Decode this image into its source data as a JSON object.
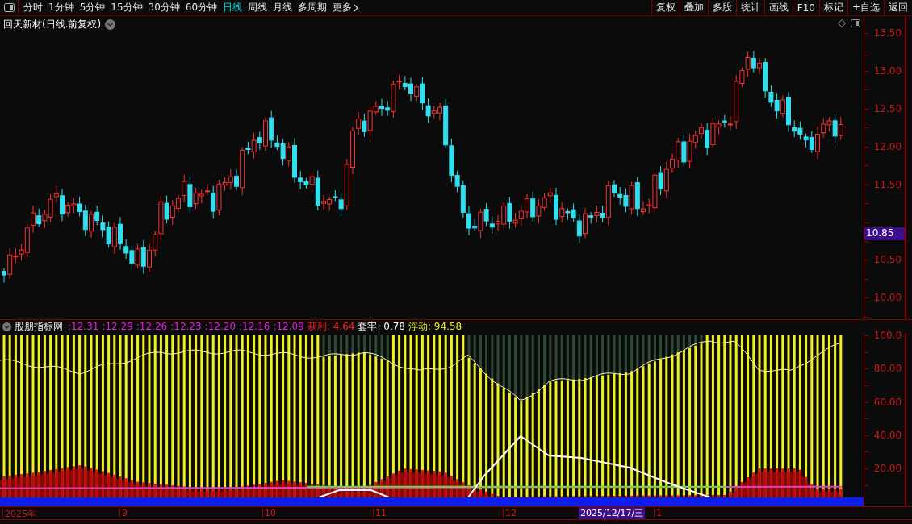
{
  "toolbar": {
    "periods": [
      {
        "label": "分时",
        "selected": false
      },
      {
        "label": "1分钟",
        "selected": false
      },
      {
        "label": "5分钟",
        "selected": false
      },
      {
        "label": "15分钟",
        "selected": false
      },
      {
        "label": "30分钟",
        "selected": false
      },
      {
        "label": "60分钟",
        "selected": false
      },
      {
        "label": "日线",
        "selected": true
      },
      {
        "label": "周线",
        "selected": false
      },
      {
        "label": "月线",
        "selected": false
      },
      {
        "label": "多周期",
        "selected": false
      },
      {
        "label": "更多",
        "selected": false
      }
    ],
    "actions": [
      "复权",
      "叠加",
      "多股",
      "统计",
      "画线",
      "F10",
      "标记",
      "+自选",
      "返回"
    ]
  },
  "main_chart": {
    "title": "回天新材(日线.前复权)",
    "price_axis": [
      "13.50",
      "13.00",
      "12.50",
      "12.00",
      "11.50",
      "10.50",
      "10.00"
    ],
    "current_price": "10.85"
  },
  "indicator": {
    "name": "股朋指标网",
    "values": [
      ":12.31",
      ":12.29",
      ":12.26",
      ":12.23",
      ":12.20",
      ":12.16",
      ":12.09"
    ],
    "readouts": [
      {
        "text": "获利: 4.64",
        "color": "#ff2020"
      },
      {
        "text": "套牢: 0.78",
        "color": "#ffffff"
      },
      {
        "text": "浮动: 94.58",
        "color": "#e8e820"
      }
    ],
    "axis": [
      "100.0",
      "80.00",
      "60.00",
      "40.00",
      "20.00"
    ]
  },
  "date_axis": {
    "labels": [
      {
        "text": "2025年",
        "kind": "month"
      },
      {
        "text": "9",
        "kind": "month"
      },
      {
        "text": "10",
        "kind": "month"
      },
      {
        "text": "11",
        "kind": "month"
      },
      {
        "text": "12",
        "kind": "month"
      },
      {
        "text": "2025/12/17/三",
        "kind": "cursor"
      },
      {
        "text": "1",
        "kind": "month"
      }
    ]
  }
}
